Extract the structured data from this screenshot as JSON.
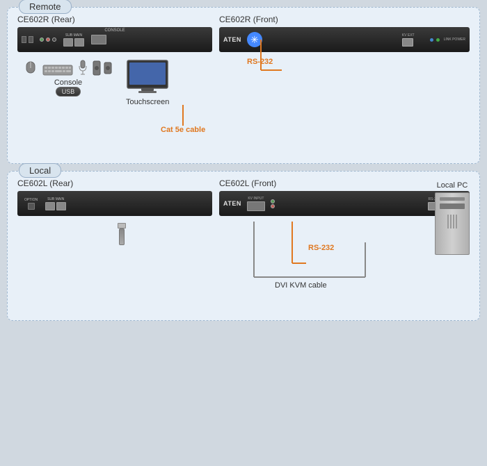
{
  "remote_label": "Remote",
  "local_label": "Local",
  "remote": {
    "rear_label": "CE602R (Rear)",
    "front_label": "CE602R (Front)",
    "console_label": "Console",
    "usb_badge": "USB",
    "touchscreen_label": "Touchscreen",
    "rs232_label": "RS-232"
  },
  "local": {
    "rear_label": "CE602L (Rear)",
    "front_label": "CE602L (Front)",
    "cat5e_label": "Cat 5e cable",
    "rs232_label": "RS-232",
    "dvi_kvm_label": "DVI KVM cable",
    "local_pc_label": "Local PC"
  }
}
